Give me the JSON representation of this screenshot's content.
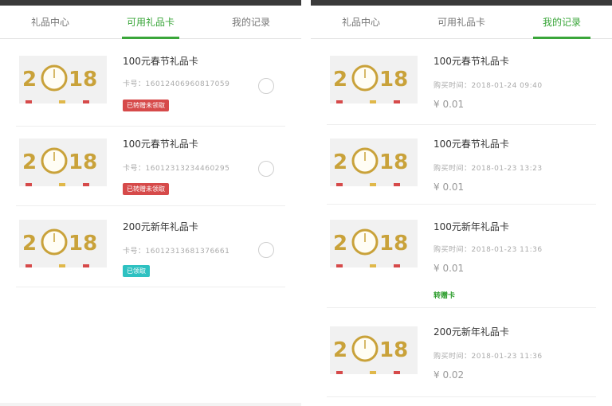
{
  "tabs": [
    "礼品中心",
    "可用礼品卡",
    "我的记录"
  ],
  "thumb_text": {
    "left": "2",
    "right": "18"
  },
  "colors": {
    "accent": "#3aa63a",
    "badge_red": "#d64a4a",
    "badge_teal": "#2ec1c1",
    "gold": "#c9a23a"
  },
  "left_panel": {
    "active_tab": "可用礼品卡",
    "cards": [
      {
        "name": "100元春节礼品卡",
        "card_no": "卡号：16012406960817059",
        "badge": "已转赠未领取",
        "badge_color": "red",
        "selectable": true
      },
      {
        "name": "100元春节礼品卡",
        "card_no": "卡号：16012313234460295",
        "badge": "已转赠未领取",
        "badge_color": "red",
        "selectable": true
      },
      {
        "name": "200元新年礼品卡",
        "card_no": "卡号：16012313681376661",
        "badge": "已领取",
        "badge_color": "teal",
        "selectable": true
      }
    ]
  },
  "right_panel": {
    "active_tab": "我的记录",
    "records": [
      {
        "name": "100元春节礼品卡",
        "time": "购买时间：2018-01-24 09:40",
        "price": "¥ 0.01",
        "tag": ""
      },
      {
        "name": "100元春节礼品卡",
        "time": "购买时间：2018-01-23 13:23",
        "price": "¥ 0.01",
        "tag": ""
      },
      {
        "name": "100元新年礼品卡",
        "time": "购买时间：2018-01-23 11:36",
        "price": "¥ 0.01",
        "tag": "转赠卡"
      },
      {
        "name": "200元新年礼品卡",
        "time": "购买时间：2018-01-23 11:36",
        "price": "¥ 0.02",
        "tag": ""
      }
    ]
  }
}
